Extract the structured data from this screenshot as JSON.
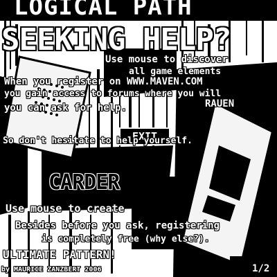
{
  "header": {
    "banner_text": "LOGICAL PATH",
    "title": "SEEKING HELP?"
  },
  "info": {
    "mouse_hint": "Use mouse to discover",
    "mouse_hint_tail": "all game elements",
    "register_line": "When you register on WWW.MAVEN.COM",
    "access_line1": "you gain access to forums where you will",
    "access_line2": "you can ask for help.",
    "domain_tag": "RAUEN"
  },
  "exit_button": {
    "label": "EXIT"
  },
  "hesitate": "So don't hesitate to help yourself.",
  "carder": {
    "label": "CARDER",
    "subtitle": "Use mouse to create"
  },
  "footnote": {
    "line1": "Besides before you ask, registering",
    "line2": "is completely free (why else?)."
  },
  "ultimate": "ULTIMATE PATTERN!",
  "footer": {
    "credit": "by MAURICE ZANZBERT 2006",
    "page_indicator": "1/2"
  },
  "colors": {
    "ink": "#000000",
    "paper": "#ffffff",
    "panel_light": "#f2f2f2"
  }
}
